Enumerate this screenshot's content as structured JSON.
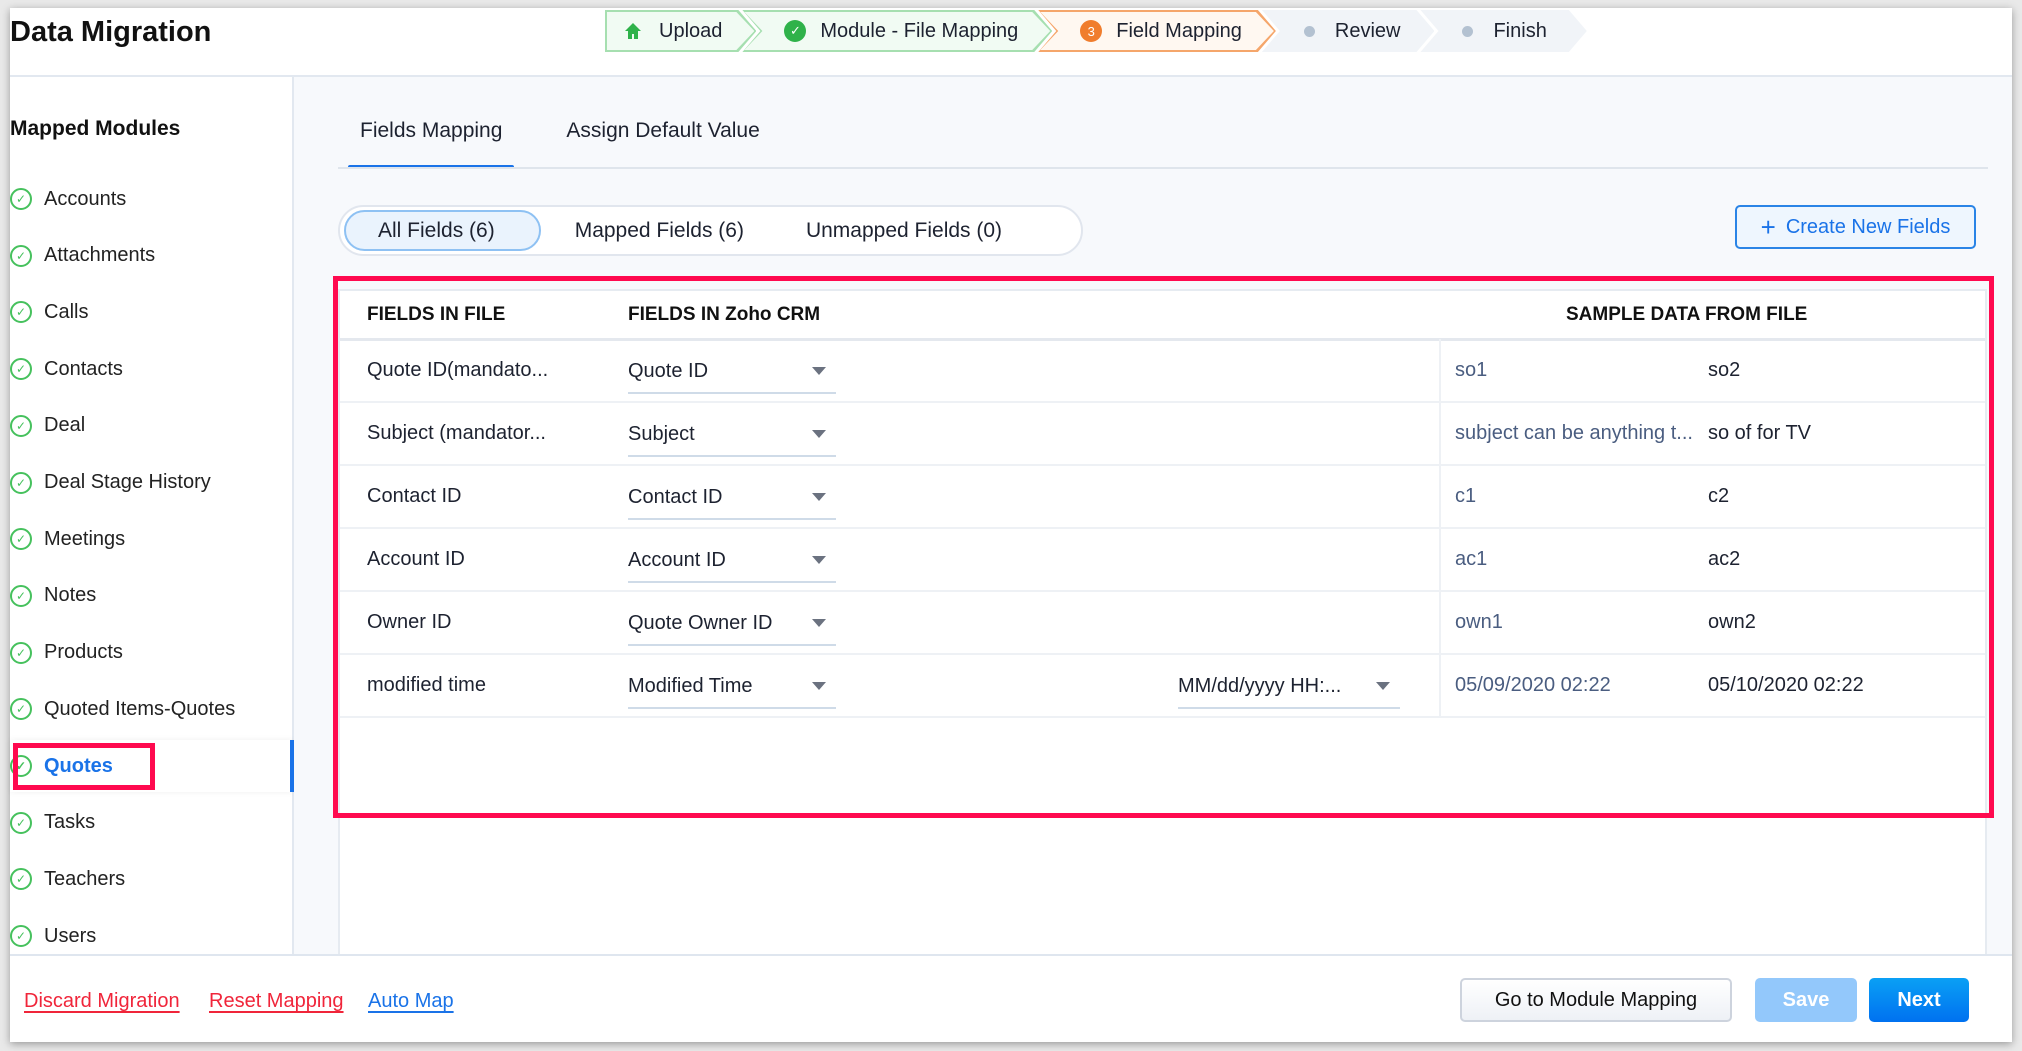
{
  "header": {
    "title": "Data Migration"
  },
  "steps": [
    {
      "label": "Upload",
      "state": "done",
      "icon": "home-icon"
    },
    {
      "label": "Module - File Mapping",
      "state": "done",
      "icon": "check-circle-icon"
    },
    {
      "label": "Field Mapping",
      "state": "current",
      "number": "3"
    },
    {
      "label": "Review",
      "state": "todo"
    },
    {
      "label": "Finish",
      "state": "todo"
    }
  ],
  "sidebar": {
    "title": "Mapped Modules",
    "active": "Quotes",
    "items": [
      "Accounts",
      "Attachments",
      "Calls",
      "Contacts",
      "Deal",
      "Deal Stage History",
      "Meetings",
      "Notes",
      "Products",
      "Quoted Items-Quotes",
      "Quotes",
      "Tasks",
      "Teachers",
      "Users"
    ]
  },
  "tabs": [
    {
      "label": "Fields Mapping",
      "active": true
    },
    {
      "label": "Assign Default Value",
      "active": false
    }
  ],
  "filters": [
    {
      "label": "All Fields (6)",
      "selected": true
    },
    {
      "label": "Mapped Fields (6)"
    },
    {
      "label": "Unmapped Fields (0)"
    }
  ],
  "create_button": "Create New Fields",
  "table": {
    "headers": {
      "file": "FIELDS IN FILE",
      "crm": "FIELDS IN Zoho CRM",
      "sample": "SAMPLE DATA FROM FILE"
    },
    "rows": [
      {
        "file": "Quote ID(mandato...",
        "crm": "Quote ID",
        "s1": "so1",
        "s2": "so2"
      },
      {
        "file": "Subject (mandator...",
        "crm": "Subject",
        "s1": "subject can be anything t...",
        "s2": "so of for TV"
      },
      {
        "file": "Contact ID",
        "crm": "Contact ID",
        "s1": "c1",
        "s2": "c2"
      },
      {
        "file": "Account ID",
        "crm": "Account ID",
        "s1": "ac1",
        "s2": "ac2"
      },
      {
        "file": "Owner ID",
        "crm": "Quote Owner ID",
        "s1": "own1",
        "s2": "own2"
      },
      {
        "file": "modified time",
        "crm": "Modified Time",
        "format": "MM/dd/yyyy HH:...",
        "s1": "05/09/2020 02:22",
        "s2": "05/10/2020 02:22"
      }
    ]
  },
  "footer": {
    "discard": "Discard Migration",
    "reset": "Reset Mapping",
    "auto": "Auto Map",
    "go_module": "Go to Module Mapping",
    "save": "Save",
    "next": "Next"
  },
  "colors": {
    "accent": "#1a73e8",
    "highlight": "#ff0a4f",
    "danger": "#f0253a",
    "success": "#2fb24a",
    "current_step": "#f07d2d"
  }
}
